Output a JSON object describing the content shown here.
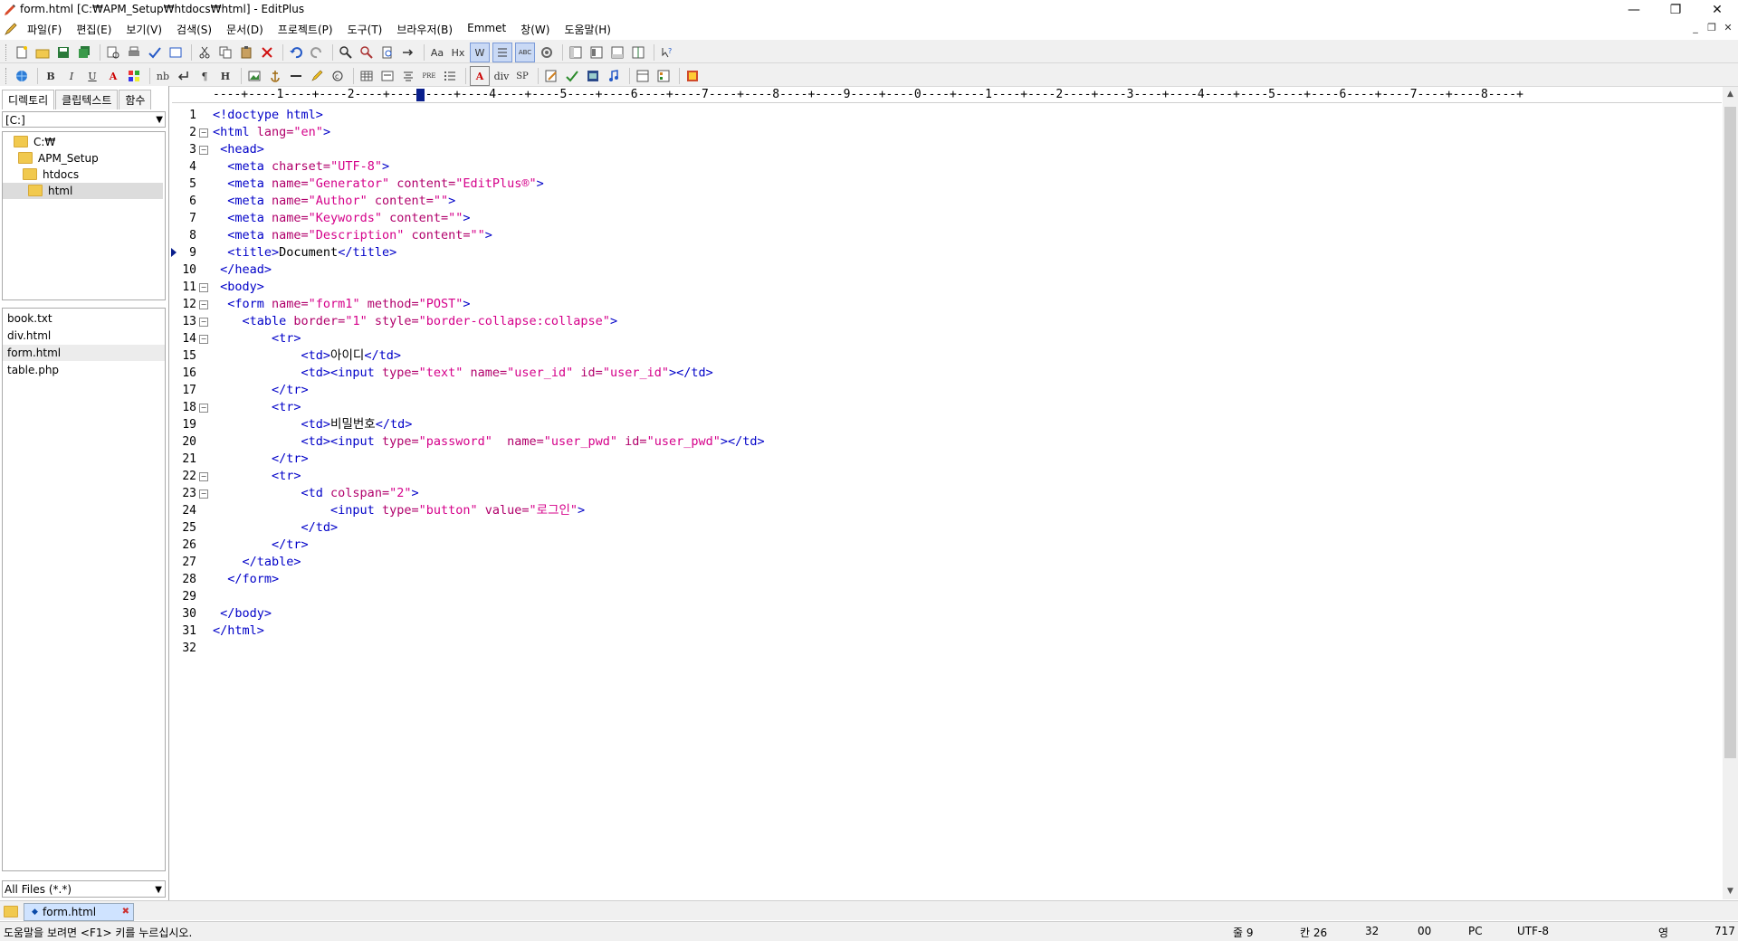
{
  "window": {
    "title": "form.html [C:₩APM_Setup₩htdocs₩html] - EditPlus",
    "minimize": "—",
    "restore": "❐",
    "close": "✕"
  },
  "menu": {
    "items": [
      "파일(F)",
      "편집(E)",
      "보기(V)",
      "검색(S)",
      "문서(D)",
      "프로젝트(P)",
      "도구(T)",
      "브라우저(B)",
      "Emmet",
      "창(W)",
      "도움말(H)"
    ],
    "mdi_min": "_",
    "mdi_restore": "❐",
    "mdi_close": "✕"
  },
  "toolbar2": {
    "bold": "B",
    "italic": "I",
    "underline": "U",
    "font": "A",
    "nb": "nb",
    "para": "¶",
    "heading": "H",
    "font2": "A",
    "div": "div",
    "sp": "SP",
    "pre": "PRE"
  },
  "toolbar1": {
    "aa": "Aa",
    "hx": "Hx",
    "w": "W",
    "abc": "ABC"
  },
  "sidebar": {
    "tabs": [
      "디렉토리",
      "클립텍스트",
      "함수"
    ],
    "drive": "[C:]",
    "tree": [
      "C:₩",
      "APM_Setup",
      "htdocs",
      "html"
    ],
    "files": [
      "book.txt",
      "div.html",
      "form.html",
      "table.php"
    ],
    "filter": "All Files (*.*)"
  },
  "ruler": "----+----1----+----2----+----3----+----4----+----5----+----6----+----7----+----8----+----9----+----0----+----1----+----2----+----3----+----4----+----5----+----6----+----7----+----8----+",
  "editor": {
    "line_numbers": [
      "1",
      "2",
      "3",
      "4",
      "5",
      "6",
      "7",
      "8",
      "9",
      "10",
      "11",
      "12",
      "13",
      "14",
      "15",
      "16",
      "17",
      "18",
      "19",
      "20",
      "21",
      "22",
      "23",
      "24",
      "25",
      "26",
      "27",
      "28",
      "29",
      "30",
      "31",
      "32"
    ],
    "lines": [
      [
        [
          "tg",
          "<!doctype html>"
        ]
      ],
      [
        [
          "tg",
          "<html "
        ],
        [
          "at",
          "lang="
        ],
        [
          "vl",
          "\"en\""
        ],
        [
          "tg",
          ">"
        ]
      ],
      [
        [
          "tg",
          " <head>"
        ]
      ],
      [
        [
          "tg",
          "  <meta "
        ],
        [
          "at",
          "charset="
        ],
        [
          "vl",
          "\"UTF-8\""
        ],
        [
          "tg",
          ">"
        ]
      ],
      [
        [
          "tg",
          "  <meta "
        ],
        [
          "at",
          "name="
        ],
        [
          "vl",
          "\"Generator\""
        ],
        [
          "at",
          " content="
        ],
        [
          "vl",
          "\"EditPlus®\""
        ],
        [
          "tg",
          ">"
        ]
      ],
      [
        [
          "tg",
          "  <meta "
        ],
        [
          "at",
          "name="
        ],
        [
          "vl",
          "\"Author\""
        ],
        [
          "at",
          " content="
        ],
        [
          "vl",
          "\"\""
        ],
        [
          "tg",
          ">"
        ]
      ],
      [
        [
          "tg",
          "  <meta "
        ],
        [
          "at",
          "name="
        ],
        [
          "vl",
          "\"Keywords\""
        ],
        [
          "at",
          " content="
        ],
        [
          "vl",
          "\"\""
        ],
        [
          "tg",
          ">"
        ]
      ],
      [
        [
          "tg",
          "  <meta "
        ],
        [
          "at",
          "name="
        ],
        [
          "vl",
          "\"Description\""
        ],
        [
          "at",
          " content="
        ],
        [
          "vl",
          "\"\""
        ],
        [
          "tg",
          ">"
        ]
      ],
      [
        [
          "tg",
          "  <title>"
        ],
        [
          "tx",
          "Document"
        ],
        [
          "tg",
          "</title>"
        ]
      ],
      [
        [
          "tg",
          " </head>"
        ]
      ],
      [
        [
          "tg",
          " <body>"
        ]
      ],
      [
        [
          "tg",
          "  <form "
        ],
        [
          "at",
          "name="
        ],
        [
          "vl",
          "\"form1\""
        ],
        [
          "at",
          " method="
        ],
        [
          "vl",
          "\"POST\""
        ],
        [
          "tg",
          ">"
        ]
      ],
      [
        [
          "tg",
          "    <table "
        ],
        [
          "at",
          "border="
        ],
        [
          "vl",
          "\"1\""
        ],
        [
          "at",
          " style="
        ],
        [
          "vl",
          "\"border-collapse:collapse\""
        ],
        [
          "tg",
          ">"
        ]
      ],
      [
        [
          "tg",
          "        <tr>"
        ]
      ],
      [
        [
          "tg",
          "            <td>"
        ],
        [
          "tx",
          "아이디"
        ],
        [
          "tg",
          "</td>"
        ]
      ],
      [
        [
          "tg",
          "            <td><input "
        ],
        [
          "at",
          "type="
        ],
        [
          "vl",
          "\"text\""
        ],
        [
          "at",
          " name="
        ],
        [
          "vl",
          "\"user_id\""
        ],
        [
          "at",
          " id="
        ],
        [
          "vl",
          "\"user_id\""
        ],
        [
          "tg",
          "></td>"
        ]
      ],
      [
        [
          "tg",
          "        </tr>"
        ]
      ],
      [
        [
          "tg",
          "        <tr>"
        ]
      ],
      [
        [
          "tg",
          "            <td>"
        ],
        [
          "tx",
          "비밀번호"
        ],
        [
          "tg",
          "</td>"
        ]
      ],
      [
        [
          "tg",
          "            <td><input "
        ],
        [
          "at",
          "type="
        ],
        [
          "vl",
          "\"password\""
        ],
        [
          "at",
          "  name="
        ],
        [
          "vl",
          "\"user_pwd\""
        ],
        [
          "at",
          " id="
        ],
        [
          "vl",
          "\"user_pwd\""
        ],
        [
          "tg",
          "></td>"
        ]
      ],
      [
        [
          "tg",
          "        </tr>"
        ]
      ],
      [
        [
          "tg",
          "        <tr>"
        ]
      ],
      [
        [
          "tg",
          "            <td "
        ],
        [
          "at",
          "colspan="
        ],
        [
          "vl",
          "\"2\""
        ],
        [
          "tg",
          ">"
        ]
      ],
      [
        [
          "tg",
          "                <input "
        ],
        [
          "at",
          "type="
        ],
        [
          "vl",
          "\"button\""
        ],
        [
          "at",
          " value="
        ],
        [
          "vl",
          "\"로그인\""
        ],
        [
          "tg",
          ">"
        ]
      ],
      [
        [
          "tg",
          "            </td>"
        ]
      ],
      [
        [
          "tg",
          "        </tr>"
        ]
      ],
      [
        [
          "tg",
          "    </table>"
        ]
      ],
      [
        [
          "tg",
          "  </form>"
        ]
      ],
      [
        [
          "tx",
          ""
        ]
      ],
      [
        [
          "tg",
          " </body>"
        ]
      ],
      [
        [
          "tg",
          "</html>"
        ]
      ],
      [
        [
          "tx",
          ""
        ]
      ]
    ],
    "fold_lines": [
      2,
      3,
      11,
      12,
      13,
      14,
      18,
      22,
      23
    ],
    "current_line": 9
  },
  "doctab": {
    "label": "form.html",
    "close": "✖"
  },
  "status": {
    "message": "도움말을 보려면 <F1> 키를 누르십시오.",
    "line": "줄 9",
    "col": "칸 26",
    "num1": "32",
    "num2": "00",
    "eol": "PC",
    "encoding": "UTF-8",
    "ime": "영",
    "size": "717"
  },
  "colors": {
    "tag": "#0000c8",
    "attr": "#b1006b",
    "value": "#d5008a",
    "accent": "#0a1f8c"
  }
}
